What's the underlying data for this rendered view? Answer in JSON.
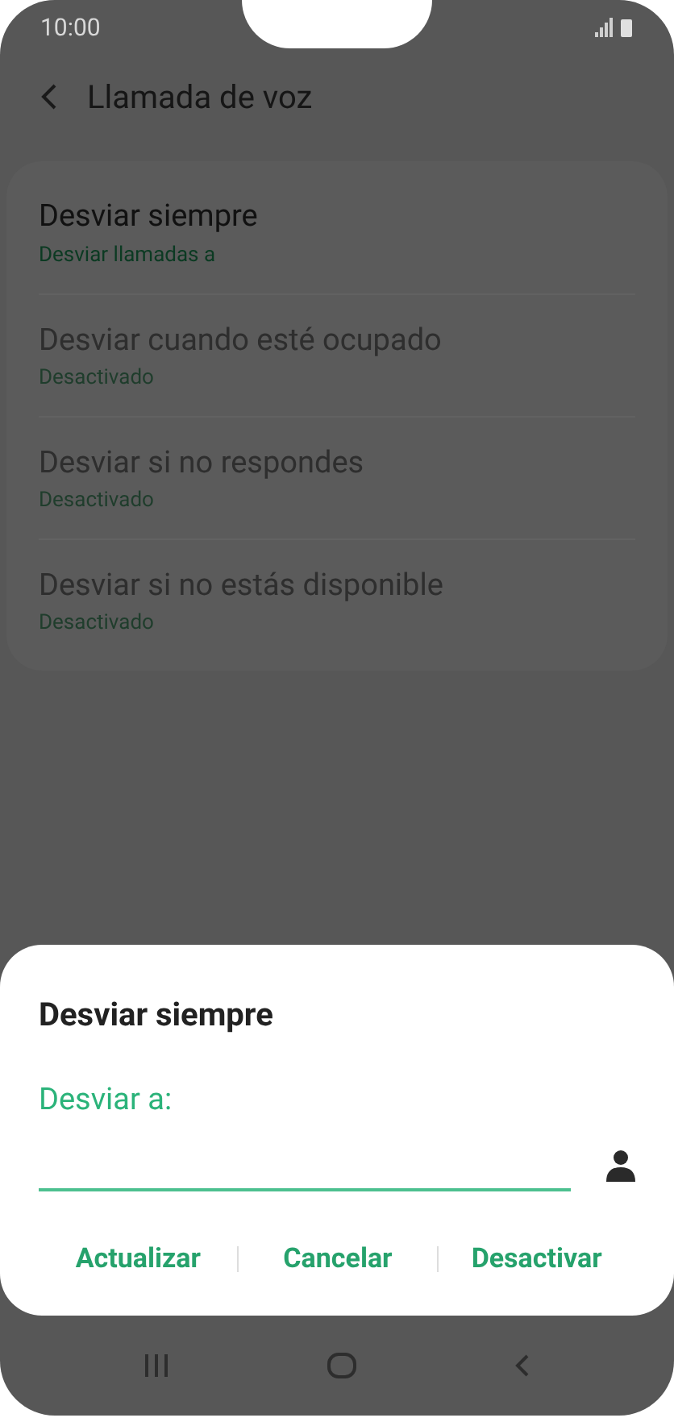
{
  "status_bar": {
    "time": "10:00"
  },
  "header": {
    "title": "Llamada de voz"
  },
  "settings": [
    {
      "title": "Desviar siempre",
      "subtitle": "Desviar llamadas a",
      "disabled": false
    },
    {
      "title": "Desviar cuando esté ocupado",
      "subtitle": "Desactivado",
      "disabled": true
    },
    {
      "title": "Desviar si no respondes",
      "subtitle": "Desactivado",
      "disabled": true
    },
    {
      "title": "Desviar si no estás disponible",
      "subtitle": "Desactivado",
      "disabled": true
    }
  ],
  "dialog": {
    "title": "Desviar siempre",
    "field_label": "Desviar a:",
    "buttons": [
      "Actualizar",
      "Cancelar",
      "Desactivar"
    ]
  }
}
